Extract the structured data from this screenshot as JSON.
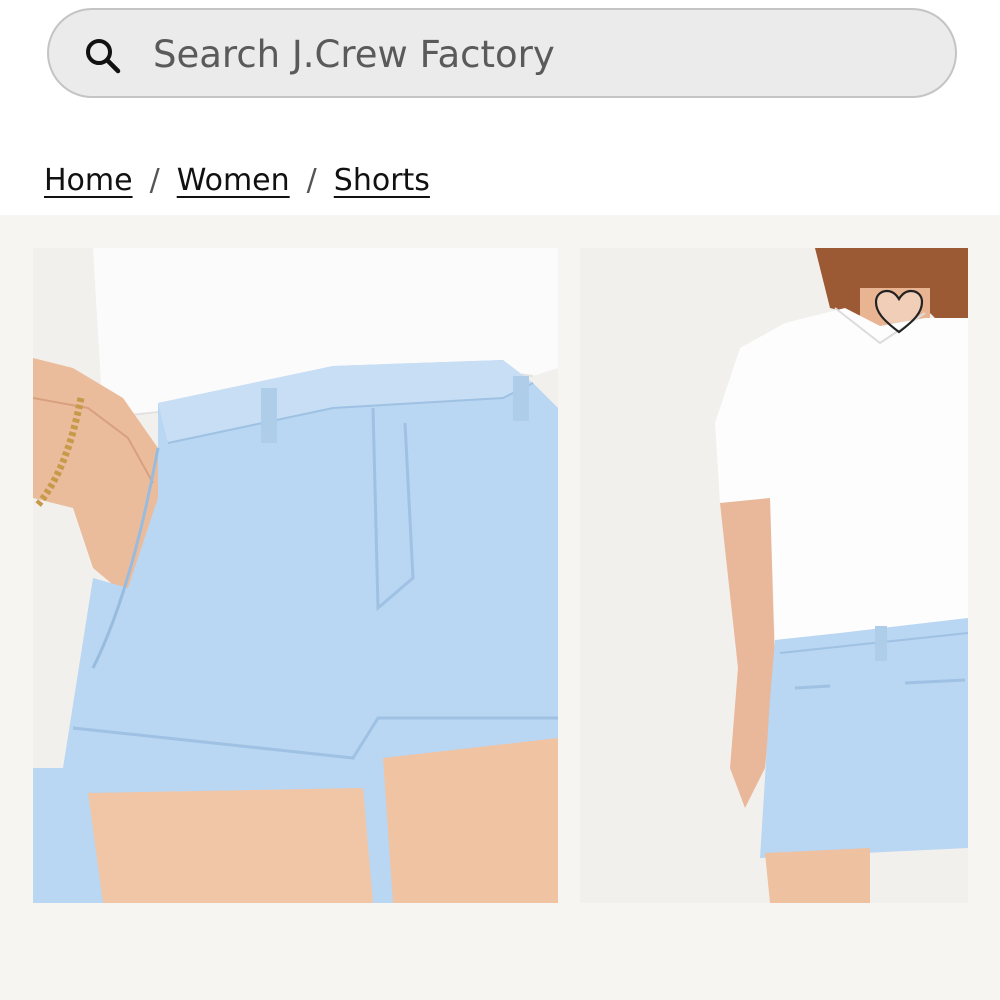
{
  "search": {
    "placeholder": "Search J.Crew Factory"
  },
  "breadcrumb": {
    "items": [
      "Home",
      "Women",
      "Shorts"
    ],
    "separator": "/"
  },
  "colors": {
    "search_bg": "#ebebeb",
    "gallery_bg": "#f7f5f2",
    "shorts_blue": "#b9d6f2"
  },
  "icons": {
    "search": "search-icon",
    "favorite": "heart-outline-icon"
  }
}
